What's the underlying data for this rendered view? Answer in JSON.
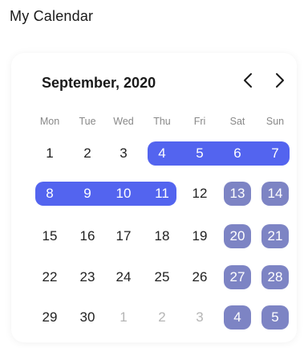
{
  "app": {
    "title": "My Calendar"
  },
  "calendar": {
    "month_label": "September, 2020",
    "prev_icon": "chevron-left-icon",
    "next_icon": "chevron-right-icon",
    "weekdays": [
      "Mon",
      "Tue",
      "Wed",
      "Thu",
      "Fri",
      "Sat",
      "Sun"
    ],
    "weeks": [
      [
        {
          "d": "1",
          "s": "normal"
        },
        {
          "d": "2",
          "s": "normal"
        },
        {
          "d": "3",
          "s": "normal"
        },
        {
          "d": "4",
          "s": "range"
        },
        {
          "d": "5",
          "s": "range"
        },
        {
          "d": "6",
          "s": "range"
        },
        {
          "d": "7",
          "s": "range"
        }
      ],
      [
        {
          "d": "8",
          "s": "range"
        },
        {
          "d": "9",
          "s": "range"
        },
        {
          "d": "10",
          "s": "range"
        },
        {
          "d": "11",
          "s": "range"
        },
        {
          "d": "12",
          "s": "normal"
        },
        {
          "d": "13",
          "s": "weekend"
        },
        {
          "d": "14",
          "s": "weekend"
        }
      ],
      [
        {
          "d": "15",
          "s": "normal"
        },
        {
          "d": "16",
          "s": "normal"
        },
        {
          "d": "17",
          "s": "normal"
        },
        {
          "d": "18",
          "s": "normal"
        },
        {
          "d": "19",
          "s": "normal"
        },
        {
          "d": "20",
          "s": "weekend"
        },
        {
          "d": "21",
          "s": "weekend"
        }
      ],
      [
        {
          "d": "22",
          "s": "normal"
        },
        {
          "d": "23",
          "s": "normal"
        },
        {
          "d": "24",
          "s": "normal"
        },
        {
          "d": "25",
          "s": "normal"
        },
        {
          "d": "26",
          "s": "normal"
        },
        {
          "d": "27",
          "s": "weekend"
        },
        {
          "d": "28",
          "s": "weekend"
        }
      ],
      [
        {
          "d": "29",
          "s": "normal"
        },
        {
          "d": "30",
          "s": "normal"
        },
        {
          "d": "1",
          "s": "muted"
        },
        {
          "d": "2",
          "s": "muted"
        },
        {
          "d": "3",
          "s": "muted"
        },
        {
          "d": "4",
          "s": "weekend"
        },
        {
          "d": "5",
          "s": "weekend"
        }
      ]
    ],
    "colors": {
      "range": "#5364ef",
      "weekend": "#7d84c4",
      "muted_text": "#b5b5b5"
    }
  }
}
